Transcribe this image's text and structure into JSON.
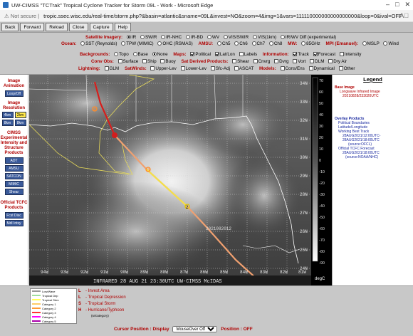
{
  "window": {
    "title": "UW-CIMSS \"TCTrak\" Tropical Cyclone Tracker for Storm 09L - Work - Microsoft Edge"
  },
  "address": {
    "warning": "Not secure",
    "url": "tropic.ssec.wisc.edu/real-time/storm.php?&basin=atlantic&sname=09L&invest=NO&zoom=4&img=1&vars=111110000000000000000&loop=0&ival=OFF"
  },
  "nav": [
    "Back",
    "Forward",
    "Reload",
    "Close",
    "Capture",
    "Help"
  ],
  "options": {
    "sat_label": "Satellite Imagery:",
    "sat_items": [
      "IR",
      "SWIR",
      "IR-NHC",
      "IR-BD",
      "WV",
      "VIS/SWIR",
      "VIS(1km)",
      "IR/WV Diff (experimental)"
    ],
    "ocean_label": "Ocean:",
    "ocean_items": [
      "SST (Reynolds)",
      "TPW (MIMIC)",
      "OHC (RSMAS)"
    ],
    "amsu_label": "AMSU:",
    "amsu_items": [
      "Ch5",
      "Ch6",
      "Ch7",
      "Ch8"
    ],
    "mw_label": "MW:",
    "mw_items": [
      "85GHz"
    ],
    "mpi_label": "MPI (Emanuel):",
    "mpi_items": [
      "MSLP",
      "Wind"
    ],
    "bg_label": "Backgrounds:",
    "bg_items": [
      "Topo",
      "Base",
      "None"
    ],
    "maps_label": "Maps:",
    "maps_items": [
      "Political",
      "Lat/Lon",
      "Labels"
    ],
    "info_label": "Information:",
    "info_items": [
      "Track",
      "Forecast",
      "Intensity"
    ],
    "conv_label": "Conv Obs:",
    "conv_items": [
      "Surface",
      "Ship",
      "Buoy"
    ],
    "sat_derived_label": "Sat Derived Products:",
    "sat_derived_items": [
      "Shear",
      "Cnvrg",
      "Dvrg",
      "Vort",
      "DLM",
      "Dry Air"
    ],
    "lightning_label": "Lightning:",
    "lightning_items": [
      "GLM"
    ],
    "satwinds_label": "SatWinds:",
    "satwinds_items": [
      "Upper-Lev",
      "Lower-Lev",
      "Sfc-Adj",
      "ASCAT"
    ],
    "models_label": "Models:",
    "models_items": [
      "Cons/Ens",
      "Dynamical",
      "Other"
    ]
  },
  "left_panel": {
    "animation": "Image Animation",
    "loop_btn": "Loop/Off",
    "resolution": "Image Resolution",
    "res_btns": [
      "4km",
      "2km",
      "8km",
      "8km"
    ],
    "cimss": "CIMSS Experimental Intensity and Structure Products",
    "prod_btns": [
      "ADT",
      "AMSU",
      "SATCON",
      "MIMIC",
      "Shear"
    ],
    "official": "Official TCFC Products",
    "off_btns": [
      "Fcst Disc",
      "Mdl Intsy"
    ]
  },
  "image": {
    "ts_label": "2021082012",
    "footer": "INFRARED    28 AUG 21    23:30UTC    UW-CIMSS        McIDAS",
    "lon_labels": [
      "94W",
      "93W",
      "92W",
      "91W",
      "90W",
      "89W",
      "88W",
      "87W",
      "86W",
      "85W",
      "84W",
      "83W",
      "82W",
      "81W"
    ],
    "lat_labels": [
      "34N",
      "33N",
      "32N",
      "31N",
      "30N",
      "29N",
      "28N",
      "27N",
      "26N",
      "25N",
      "24N"
    ],
    "track_labels": [
      "2",
      "3",
      "4"
    ]
  },
  "colorbar": {
    "ticks": [
      "70",
      "60",
      "50",
      "40",
      "30",
      "20",
      "10",
      "0",
      "-10",
      "-20",
      "-30",
      "-40",
      "-50",
      "-60",
      "-70",
      "-80",
      "-90"
    ],
    "unit": "degC"
  },
  "legend": {
    "title": "Legend",
    "base_image": "Base Image",
    "base_lines": [
      "Longwave Infrared Image",
      "20210828/233020UTC"
    ],
    "overlay": "Overlay Products",
    "overlay_lines": [
      "Political Boundaries",
      "Latitude/Longitude",
      "Working Best Track",
      "28AUG2021/12:00UTC-",
      "28AUG2021/18:00UTC",
      "(source:OFCL)",
      "Official TCFC Forecast",
      "28AUG2021/18:00UTC",
      "(source:NOAA/NHC)"
    ]
  },
  "bottom": {
    "key_rows": [
      "Low/Wave",
      "Tropical Dep",
      "Tropical Strm",
      "Category 1",
      "Category 2",
      "Category 3",
      "Category 4",
      "Category 5"
    ],
    "key_colors": [
      "#ffffff",
      "#9fdf9f",
      "#ffff55",
      "#ffcc66",
      "#ff9933",
      "#ff3333",
      "#ff00ff",
      "#aa00aa"
    ],
    "legend_items": [
      {
        "sym": "L",
        "label": "- Invest Area"
      },
      {
        "sym": "L",
        "label": "- Tropical Depression"
      },
      {
        "sym": "S",
        "label": "- Tropical Storm"
      },
      {
        "sym": "H",
        "label": "- Hurricane/Typhoon"
      }
    ],
    "legend_note": "(w/category)",
    "cursor_label": "Cursor Position : Display",
    "cursor_select": "MouseOver Off",
    "cursor_pos": "Position : OFF"
  }
}
